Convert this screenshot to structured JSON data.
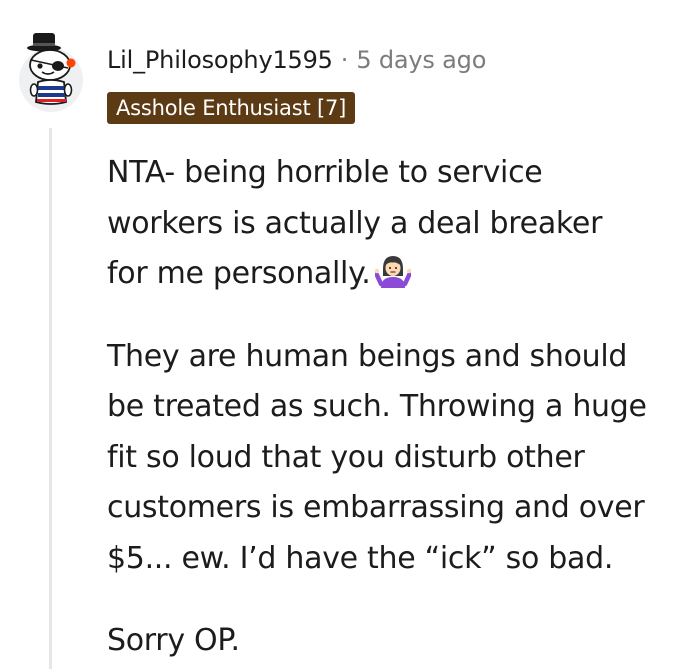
{
  "comment": {
    "username": "Lil_Philosophy1595",
    "separator": "·",
    "timestamp": "5 days ago",
    "flair": "Asshole Enthusiast [7]",
    "paragraphs": [
      {
        "lines": [
          "NTA- being horrible to service",
          "workers is actually a deal breaker",
          "for me personally."
        ],
        "emoji": "person-shrugging-emoji"
      },
      {
        "lines": [
          "They are human beings and should",
          "be treated as such. Throwing a huge",
          "fit so loud that you disturb other",
          "customers is embarrassing and over",
          "$5... ew. I’d have the “ick” so bad."
        ]
      },
      {
        "lines": [
          "Sorry OP."
        ]
      }
    ]
  },
  "colors": {
    "flair_background": "#5b3a14",
    "flair_text": "#ffffff",
    "meta_text": "#7c7c7c",
    "body_text": "#1c1c1c",
    "thread_line": "#e4e6e8"
  },
  "icons": {
    "avatar": "snoo-avatar-icon",
    "emoji": "person-shrugging-emoji"
  }
}
